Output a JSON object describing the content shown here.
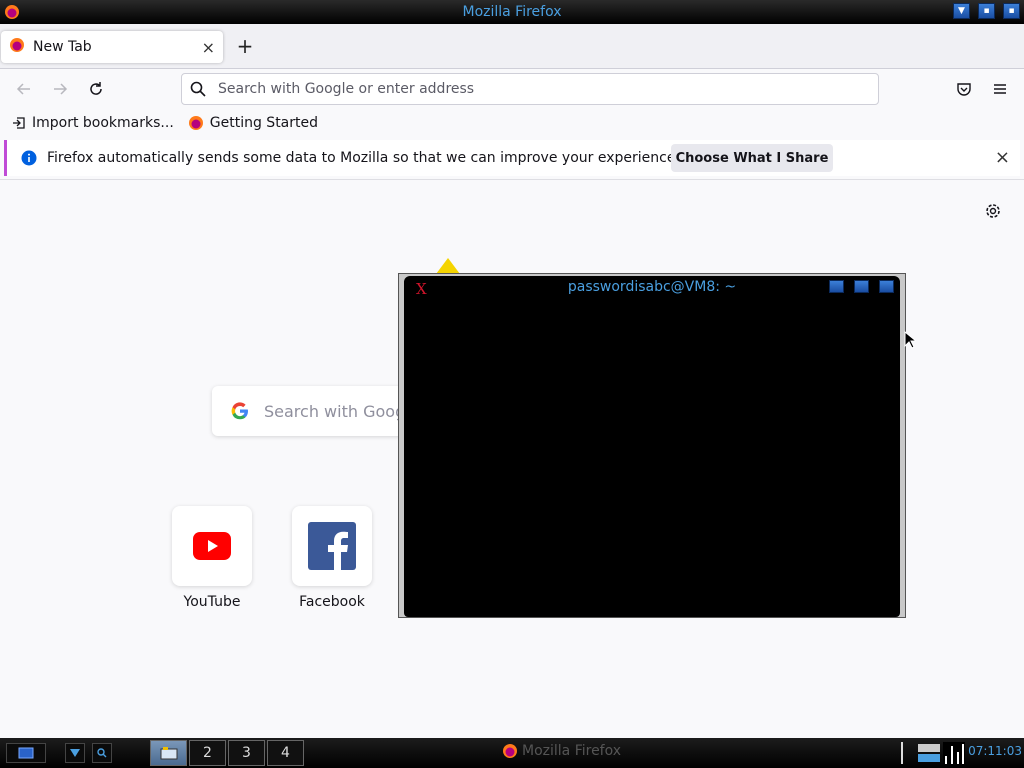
{
  "wm": {
    "window_title": "Mozilla Firefox"
  },
  "browser": {
    "tab_title": "New Tab",
    "tab_close": "×",
    "new_tab": "+",
    "url_placeholder": "Search with Google or enter address",
    "bookmarks": [
      {
        "label": "Import bookmarks...",
        "icon": "import-icon"
      },
      {
        "label": "Getting Started",
        "icon": "firefox-icon"
      }
    ],
    "notification": {
      "text": "Firefox automatically sends some data to Mozilla so that we can improve your experience.",
      "button": "Choose What I Share",
      "close": "×"
    }
  },
  "newtab": {
    "search_placeholder": "Search with Google",
    "tiles": [
      {
        "label": "YouTube",
        "icon": "youtube-icon"
      },
      {
        "label": "Facebook",
        "icon": "facebook-icon"
      }
    ]
  },
  "terminal": {
    "title": "passwordisabc@VM8: ~"
  },
  "taskbar": {
    "workspaces": [
      "2",
      "3",
      "4"
    ],
    "task_title": "Mozilla Firefox",
    "clock": "07:11:03"
  },
  "colors": {
    "accent": "#4a9fe0",
    "notification_border": "#c04bd6",
    "info_blue": "#0060df"
  }
}
